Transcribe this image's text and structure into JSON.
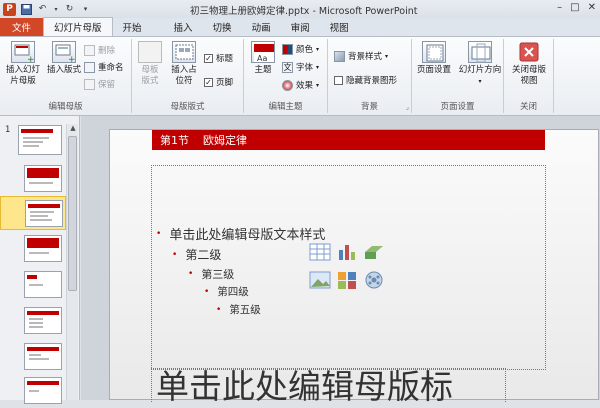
{
  "window": {
    "app_icon": "P",
    "title": "初三物理上册欧姆定律.pptx - Microsoft PowerPoint"
  },
  "tabs": [
    {
      "label": "文件"
    },
    {
      "label": "幻灯片母版"
    },
    {
      "label": "开始"
    },
    {
      "label": "插入"
    },
    {
      "label": "切换"
    },
    {
      "label": "动画"
    },
    {
      "label": "审阅"
    },
    {
      "label": "视图"
    }
  ],
  "ribbon": {
    "edit_master": {
      "label": "编辑母版",
      "insert_master": "插入幻灯片母版",
      "insert_layout": "插入版式",
      "delete": "删除",
      "rename": "重命名",
      "preserve": "保留"
    },
    "master_layout": {
      "label": "母版版式",
      "master_layout_btn": "母板版式",
      "insert_placeholder": "插入占位符",
      "title_check": "标题",
      "footer_check": "页脚"
    },
    "edit_theme": {
      "label": "编辑主题",
      "theme": "主题",
      "colors": "颜色",
      "fonts": "字体",
      "effects": "效果"
    },
    "background": {
      "label": "背景",
      "bg_styles": "背景样式",
      "hide_bg": "隐藏背景图形"
    },
    "page_setup": {
      "label": "页面设置",
      "page_setup_btn": "页面设置",
      "orientation": "幻灯片方向"
    },
    "close": {
      "label": "关闭",
      "close_master": "关闭母版视图"
    }
  },
  "thumbnails": {
    "first_number": "1"
  },
  "slide": {
    "header_section": "第1节",
    "header_title": "欧姆定律",
    "levels": [
      "单击此处编辑母版文本样式",
      "第二级",
      "第三级",
      "第四级",
      "第五级"
    ],
    "title_placeholder": "单击此处编辑母版标"
  },
  "colors": {
    "accent_red": "#c00000",
    "file_tab": "#d24726",
    "selected_thumb": "#fde68b"
  }
}
